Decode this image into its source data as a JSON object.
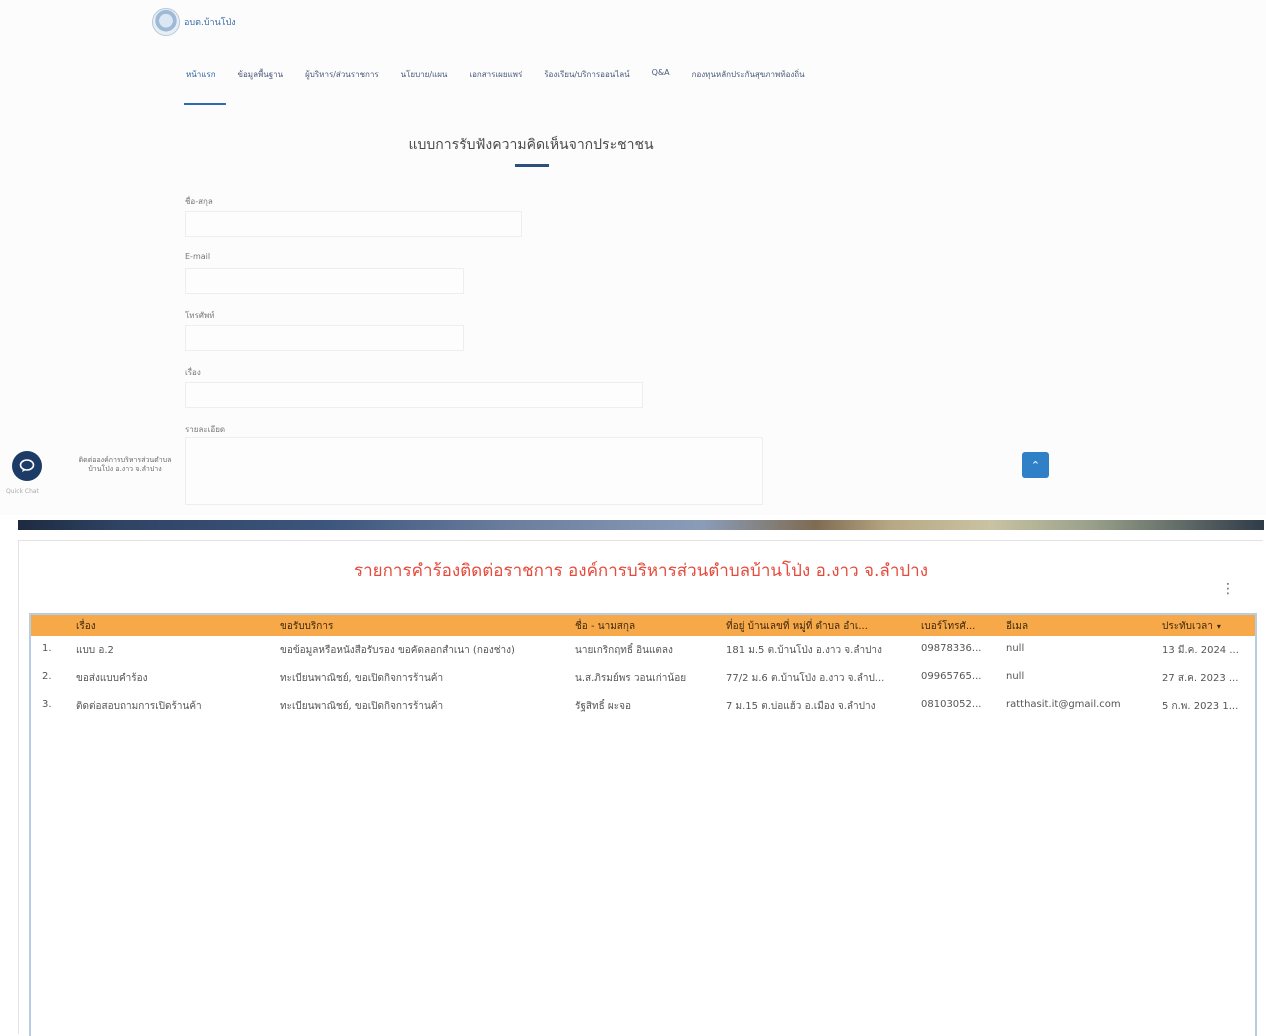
{
  "site": {
    "logo_text": "อบต.บ้านโป่ง",
    "nav": [
      "หน้าแรก",
      "ข้อมูลพื้นฐาน",
      "ผู้บริหาร/ส่วนราชการ",
      "นโยบาย/แผน",
      "เอกสารเผยแพร่",
      "ร้องเรียน/บริการออนไลน์",
      "Q&A",
      "กองทุนหลักประกันสุขภาพท้องถิ่น"
    ],
    "form_title": "แบบการรับฟังความคิดเห็นจากประชาชน",
    "fields": {
      "name_label": "ชื่อ-สกุล",
      "email_label": "E-mail",
      "phone_label": "โทรศัพท์",
      "subject_label": "เรื่อง",
      "detail_label": "รายละเอียด"
    },
    "chat_caption": "Quick Chat",
    "contact_text": "ติดต่อองค์การบริหารส่วนตำบลบ้านโป่ง อ.งาว จ.ลำปาง"
  },
  "report": {
    "title": "รายการคำร้องติดต่อราชการ องค์การบริหารส่วนตำบลบ้านโป่ง อ.งาว จ.ลำปาง",
    "columns": [
      "เรื่อง",
      "ขอรับบริการ",
      "ชื่อ - นามสกุล",
      "ที่อยู่ บ้านเลขที่ หมู่ที่ ตำบล อำเ...",
      "เบอร์โทรศั...",
      "อีเมล",
      "ประทับเวลา"
    ],
    "rows": [
      {
        "no": "1.",
        "subject": "แบบ อ.2",
        "service": "ขอข้อมูลหรือหนังสือรับรอง ขอคัดลอกสำเนา (กองช่าง)",
        "name": "นายเกริกฤทธิ์ อินแตลง",
        "address": "181 ม.5 ต.บ้านโป่ง อ.งาว จ.ลำปาง",
        "phone": "09878336...",
        "email": "null",
        "timestamp": "13 มี.ค. 2024 ..."
      },
      {
        "no": "2.",
        "subject": "ขอส่งแบบคำร้อง",
        "service": "ทะเบียนพาณิชย์, ขอเปิดกิจการร้านค้า",
        "name": "น.ส.ภิรมย์พร วอนเก่าน้อย",
        "address": "77/2 ม.6 ต.บ้านโป่ง อ.งาว จ.ลำป...",
        "phone": "09965765...",
        "email": "null",
        "timestamp": "27 ส.ค. 2023 ..."
      },
      {
        "no": "3.",
        "subject": "ติดต่อสอบถามการเปิดร้านค้า",
        "service": "ทะเบียนพาณิชย์, ขอเปิดกิจการร้านค้า",
        "name": "รัฐสิทธิ์ ผะจอ",
        "address": "7 ม.15 ต.บ่อแฮ้ว อ.เมือง จ.ลำปาง",
        "phone": "08103052...",
        "email": "ratthasit.it@gmail.com",
        "timestamp": "5 ก.พ. 2023 1..."
      }
    ]
  },
  "colors": {
    "accent": "#2f80c7",
    "header_orange": "#f7a94a",
    "title_red": "#e54a3c"
  }
}
